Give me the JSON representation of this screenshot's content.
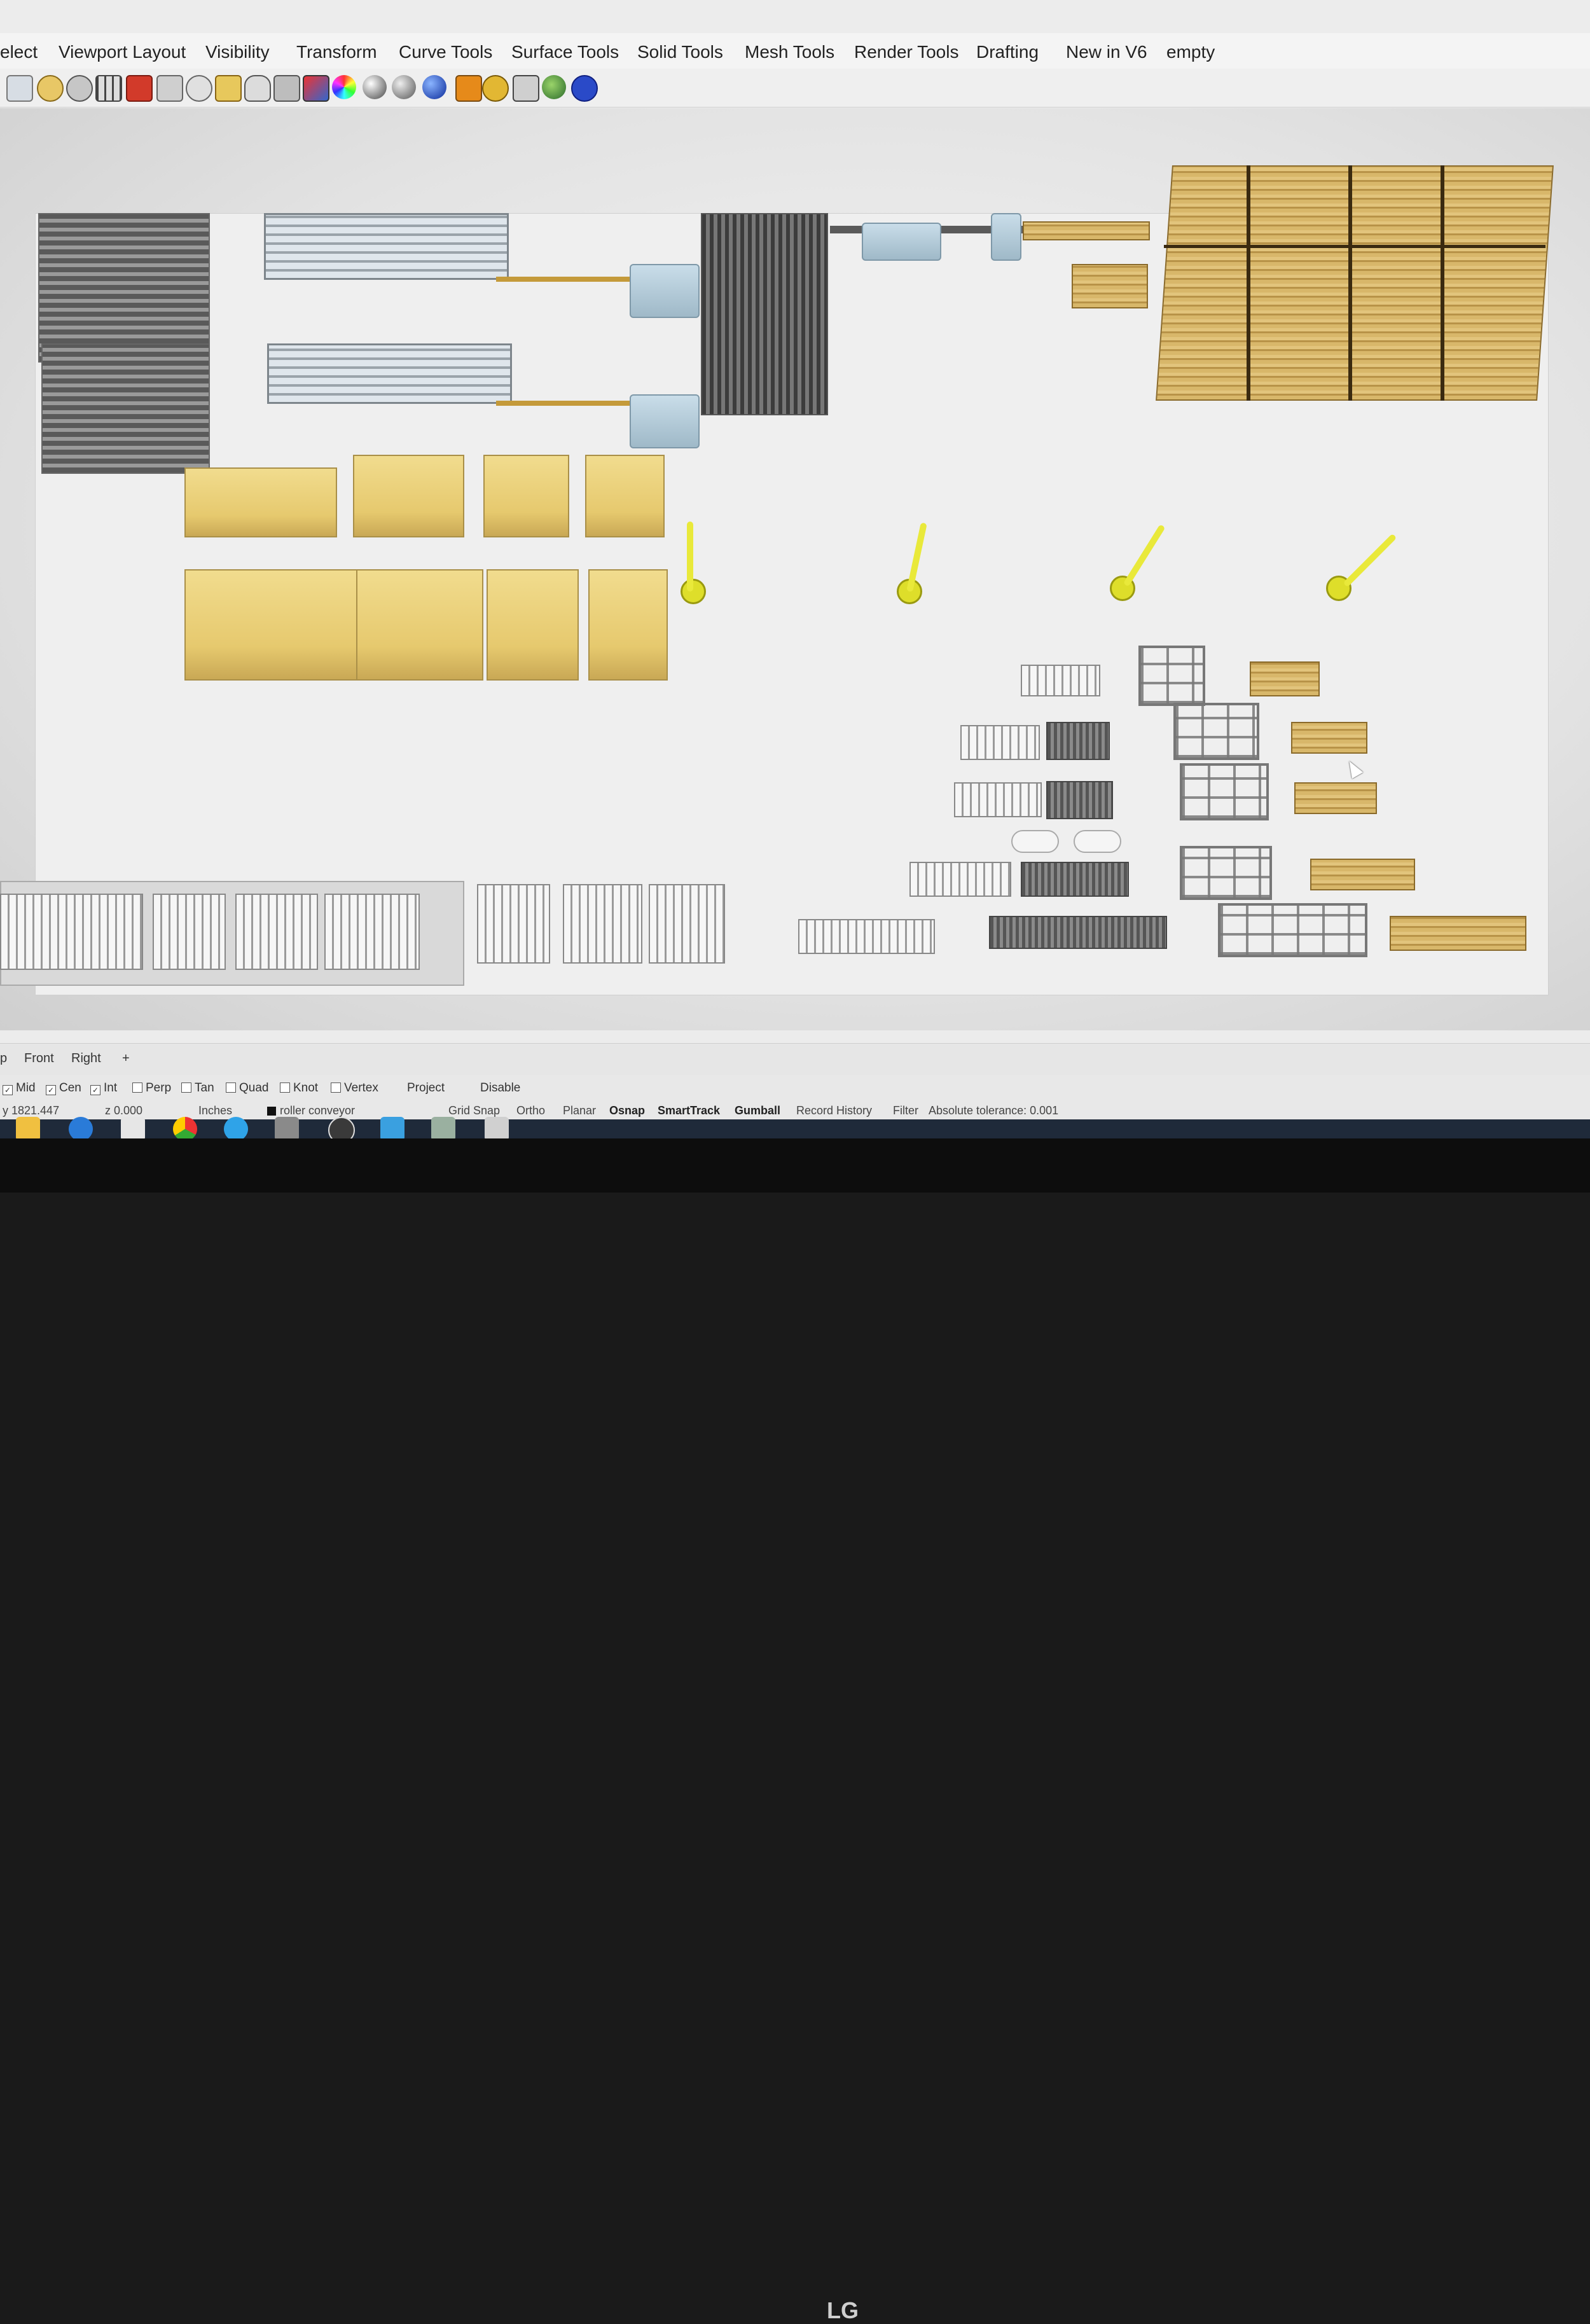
{
  "menu": {
    "tabs": [
      "elect",
      "Viewport Layout",
      "Visibility",
      "Transform",
      "Curve Tools",
      "Surface Tools",
      "Solid Tools",
      "Mesh Tools",
      "Render Tools",
      "Drafting",
      "New in V6",
      "empty"
    ]
  },
  "toolbar": {
    "icons": [
      "zoom-extents-icon",
      "zoom-window-icon",
      "rotate-view-icon",
      "grid-icon",
      "car-icon",
      "select-icon",
      "zoom-out-icon",
      "zoom-selected-icon",
      "light-icon",
      "lock-icon",
      "material-icon",
      "color-wheel-icon",
      "shaded-sphere-icon",
      "render-sphere-icon",
      "blue-sphere-icon",
      "flag-icon",
      "gear-icon",
      "network-icon",
      "globe-icon",
      "help-icon"
    ]
  },
  "viewport_tabs": [
    "p",
    "Front",
    "Right",
    "+"
  ],
  "osnap": {
    "items": [
      {
        "label": "Mid",
        "checked": true
      },
      {
        "label": "Cen",
        "checked": true
      },
      {
        "label": "Int",
        "checked": true
      },
      {
        "label": "Perp",
        "checked": false
      },
      {
        "label": "Tan",
        "checked": false
      },
      {
        "label": "Quad",
        "checked": false
      },
      {
        "label": "Knot",
        "checked": false
      },
      {
        "label": "Vertex",
        "checked": false
      }
    ],
    "project": "Project",
    "disable": "Disable"
  },
  "status": {
    "y": "y 1821.447",
    "z": "z 0.000",
    "units": "Inches",
    "layer": "roller conveyor",
    "grid_snap": "Grid Snap",
    "ortho": "Ortho",
    "planar": "Planar",
    "osnap": "Osnap",
    "smarttrack": "SmartTrack",
    "gumball": "Gumball",
    "record_history": "Record History",
    "filter": "Filter",
    "tolerance": "Absolute tolerance: 0.001"
  },
  "monitor": {
    "brand": "LG"
  }
}
